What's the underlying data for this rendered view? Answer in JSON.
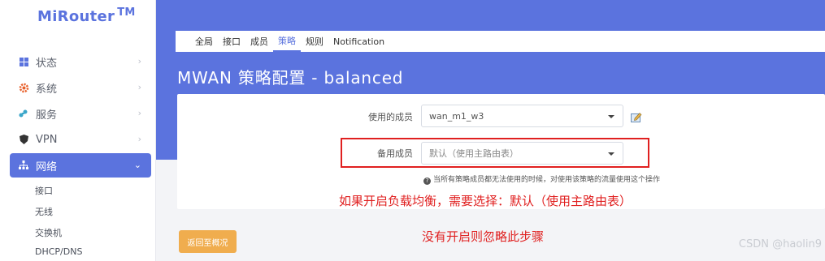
{
  "brand": {
    "name": "MiRouter",
    "tm": "TM"
  },
  "sidebar": {
    "items": [
      {
        "label": "状态",
        "icon": "dashboard-icon"
      },
      {
        "label": "系统",
        "icon": "gear-icon"
      },
      {
        "label": "服务",
        "icon": "puzzle-icon"
      },
      {
        "label": "VPN",
        "icon": "shield-icon"
      },
      {
        "label": "网络",
        "icon": "network-icon",
        "active": true
      }
    ],
    "network_sub": [
      "接口",
      "无线",
      "交换机",
      "DHCP/DNS"
    ]
  },
  "tabs": [
    "全局",
    "接口",
    "成员",
    "策略",
    "规则",
    "Notification"
  ],
  "active_tab": "策略",
  "page_title": "MWAN 策略配置 - balanced",
  "form": {
    "members_used": {
      "label": "使用的成员",
      "value": "wan_m1_w3"
    },
    "fallback_member": {
      "label": "备用成员",
      "value": "默认（使用主路由表）"
    },
    "hint": "当所有策略成员都无法使用的时候，对使用该策略的流量使用这个操作"
  },
  "annotations": {
    "note1": "如果开启负载均衡，需要选择：默认（使用主路由表）",
    "note2": "没有开启则忽略此步骤"
  },
  "back_button": "返回至概况",
  "watermark": "CSDN @haolin9",
  "colors": {
    "accent": "#5b73de",
    "highlight_red": "#e02020",
    "button_orange": "#f0ad4e"
  }
}
